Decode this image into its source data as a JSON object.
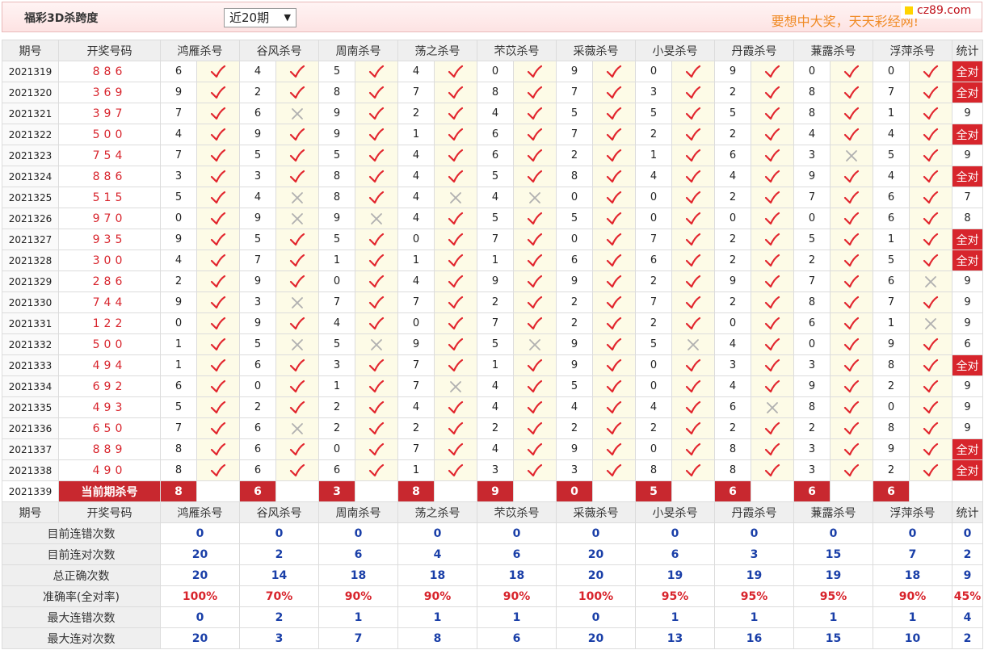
{
  "header": {
    "title": "福彩3D杀跨度",
    "period_selected": "近20期",
    "slogan": "要想中大奖，天天彩经网!",
    "logo_text": "cz89.com"
  },
  "colors": {
    "accent": "#d7252c",
    "blue": "#1a3fa8",
    "mark_bg": "#fdfbe7"
  },
  "columns": {
    "period": "期号",
    "draw": "开奖号码",
    "experts": [
      "鸿雁杀号",
      "谷风杀号",
      "周南杀号",
      "荡之杀号",
      "芣苡杀号",
      "采薇杀号",
      "小旻杀号",
      "丹霞杀号",
      "蒹露杀号",
      "浮萍杀号"
    ],
    "stat": "统计"
  },
  "rows": [
    {
      "period": "2021319",
      "draw": "886",
      "vals": [
        6,
        4,
        5,
        4,
        0,
        9,
        0,
        9,
        0,
        0
      ],
      "ok": [
        1,
        1,
        1,
        1,
        1,
        1,
        1,
        1,
        1,
        1
      ],
      "stat": "全对"
    },
    {
      "period": "2021320",
      "draw": "369",
      "vals": [
        9,
        2,
        8,
        7,
        8,
        7,
        3,
        2,
        8,
        7
      ],
      "ok": [
        1,
        1,
        1,
        1,
        1,
        1,
        1,
        1,
        1,
        1
      ],
      "stat": "全对"
    },
    {
      "period": "2021321",
      "draw": "397",
      "vals": [
        7,
        6,
        9,
        2,
        4,
        5,
        5,
        5,
        8,
        1
      ],
      "ok": [
        1,
        0,
        1,
        1,
        1,
        1,
        1,
        1,
        1,
        1
      ],
      "stat": "9"
    },
    {
      "period": "2021322",
      "draw": "500",
      "vals": [
        4,
        9,
        9,
        1,
        6,
        7,
        2,
        2,
        4,
        4
      ],
      "ok": [
        1,
        1,
        1,
        1,
        1,
        1,
        1,
        1,
        1,
        1
      ],
      "stat": "全对"
    },
    {
      "period": "2021323",
      "draw": "754",
      "vals": [
        7,
        5,
        5,
        4,
        6,
        2,
        1,
        6,
        3,
        5
      ],
      "ok": [
        1,
        1,
        1,
        1,
        1,
        1,
        1,
        1,
        0,
        1
      ],
      "stat": "9"
    },
    {
      "period": "2021324",
      "draw": "886",
      "vals": [
        3,
        3,
        8,
        4,
        5,
        8,
        4,
        4,
        9,
        4
      ],
      "ok": [
        1,
        1,
        1,
        1,
        1,
        1,
        1,
        1,
        1,
        1
      ],
      "stat": "全对"
    },
    {
      "period": "2021325",
      "draw": "515",
      "vals": [
        5,
        4,
        8,
        4,
        4,
        0,
        0,
        2,
        7,
        6
      ],
      "ok": [
        1,
        0,
        1,
        0,
        0,
        1,
        1,
        1,
        1,
        1
      ],
      "stat": "7"
    },
    {
      "period": "2021326",
      "draw": "970",
      "vals": [
        0,
        9,
        9,
        4,
        5,
        5,
        0,
        0,
        0,
        6
      ],
      "ok": [
        1,
        0,
        0,
        1,
        1,
        1,
        1,
        1,
        1,
        1
      ],
      "stat": "8"
    },
    {
      "period": "2021327",
      "draw": "935",
      "vals": [
        9,
        5,
        5,
        0,
        7,
        0,
        7,
        2,
        5,
        1
      ],
      "ok": [
        1,
        1,
        1,
        1,
        1,
        1,
        1,
        1,
        1,
        1
      ],
      "stat": "全对"
    },
    {
      "period": "2021328",
      "draw": "300",
      "vals": [
        4,
        7,
        1,
        1,
        1,
        6,
        6,
        2,
        2,
        5
      ],
      "ok": [
        1,
        1,
        1,
        1,
        1,
        1,
        1,
        1,
        1,
        1
      ],
      "stat": "全对"
    },
    {
      "period": "2021329",
      "draw": "286",
      "vals": [
        2,
        9,
        0,
        4,
        9,
        9,
        2,
        9,
        7,
        6
      ],
      "ok": [
        1,
        1,
        1,
        1,
        1,
        1,
        1,
        1,
        1,
        0
      ],
      "stat": "9"
    },
    {
      "period": "2021330",
      "draw": "744",
      "vals": [
        9,
        3,
        7,
        7,
        2,
        2,
        7,
        2,
        8,
        7
      ],
      "ok": [
        1,
        0,
        1,
        1,
        1,
        1,
        1,
        1,
        1,
        1
      ],
      "stat": "9"
    },
    {
      "period": "2021331",
      "draw": "122",
      "vals": [
        0,
        9,
        4,
        0,
        7,
        2,
        2,
        0,
        6,
        1
      ],
      "ok": [
        1,
        1,
        1,
        1,
        1,
        1,
        1,
        1,
        1,
        0
      ],
      "stat": "9"
    },
    {
      "period": "2021332",
      "draw": "500",
      "vals": [
        1,
        5,
        5,
        9,
        5,
        9,
        5,
        4,
        0,
        9
      ],
      "ok": [
        1,
        0,
        0,
        1,
        0,
        1,
        0,
        1,
        1,
        1
      ],
      "stat": "6"
    },
    {
      "period": "2021333",
      "draw": "494",
      "vals": [
        1,
        6,
        3,
        7,
        1,
        9,
        0,
        3,
        3,
        8
      ],
      "ok": [
        1,
        1,
        1,
        1,
        1,
        1,
        1,
        1,
        1,
        1
      ],
      "stat": "全对"
    },
    {
      "period": "2021334",
      "draw": "692",
      "vals": [
        6,
        0,
        1,
        7,
        4,
        5,
        0,
        4,
        9,
        2
      ],
      "ok": [
        1,
        1,
        1,
        0,
        1,
        1,
        1,
        1,
        1,
        1
      ],
      "stat": "9"
    },
    {
      "period": "2021335",
      "draw": "493",
      "vals": [
        5,
        2,
        2,
        4,
        4,
        4,
        4,
        6,
        8,
        0
      ],
      "ok": [
        1,
        1,
        1,
        1,
        1,
        1,
        1,
        0,
        1,
        1
      ],
      "stat": "9"
    },
    {
      "period": "2021336",
      "draw": "650",
      "vals": [
        7,
        6,
        2,
        2,
        2,
        2,
        2,
        2,
        2,
        8
      ],
      "ok": [
        1,
        0,
        1,
        1,
        1,
        1,
        1,
        1,
        1,
        1
      ],
      "stat": "9"
    },
    {
      "period": "2021337",
      "draw": "889",
      "vals": [
        8,
        6,
        0,
        7,
        4,
        9,
        0,
        8,
        3,
        9
      ],
      "ok": [
        1,
        1,
        1,
        1,
        1,
        1,
        1,
        1,
        1,
        1
      ],
      "stat": "全对"
    },
    {
      "period": "2021338",
      "draw": "490",
      "vals": [
        8,
        6,
        6,
        1,
        3,
        3,
        8,
        8,
        3,
        2
      ],
      "ok": [
        1,
        1,
        1,
        1,
        1,
        1,
        1,
        1,
        1,
        1
      ],
      "stat": "全对"
    }
  ],
  "current": {
    "period": "2021339",
    "label": "当前期杀号",
    "kills": [
      "8",
      "6",
      "3",
      "8",
      "9",
      "0",
      "5",
      "6",
      "6",
      "6"
    ]
  },
  "summary": [
    {
      "label": "目前连错次数",
      "vals": [
        "0",
        "0",
        "0",
        "0",
        "0",
        "0",
        "0",
        "0",
        "0",
        "0"
      ],
      "stat": "0",
      "red": false
    },
    {
      "label": "目前连对次数",
      "vals": [
        "20",
        "2",
        "6",
        "4",
        "6",
        "20",
        "6",
        "3",
        "15",
        "7"
      ],
      "stat": "2",
      "red": false
    },
    {
      "label": "总正确次数",
      "vals": [
        "20",
        "14",
        "18",
        "18",
        "18",
        "20",
        "19",
        "19",
        "19",
        "18"
      ],
      "stat": "9",
      "red": false
    },
    {
      "label": "准确率(全对率)",
      "vals": [
        "100%",
        "70%",
        "90%",
        "90%",
        "90%",
        "100%",
        "95%",
        "95%",
        "95%",
        "90%"
      ],
      "stat": "45%",
      "red": true
    },
    {
      "label": "最大连错次数",
      "vals": [
        "0",
        "2",
        "1",
        "1",
        "1",
        "0",
        "1",
        "1",
        "1",
        "1"
      ],
      "stat": "4",
      "red": false
    },
    {
      "label": "最大连对次数",
      "vals": [
        "20",
        "3",
        "7",
        "8",
        "6",
        "20",
        "13",
        "16",
        "15",
        "10"
      ],
      "stat": "2",
      "red": false
    }
  ]
}
